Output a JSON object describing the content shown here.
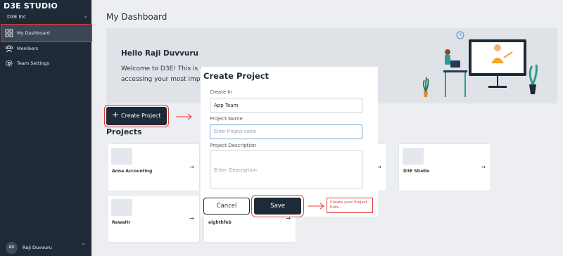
{
  "sidebar": {
    "brand": "D3E STUDIO",
    "org": "D3E Inc",
    "items": [
      {
        "label": "My Dashboard",
        "icon": "dashboard-icon",
        "active": true
      },
      {
        "label": "Members",
        "icon": "members-icon"
      },
      {
        "label": "Team Settings",
        "icon": "settings-icon"
      }
    ],
    "user": {
      "initials": "RD",
      "name": "Raji Duvvuru"
    }
  },
  "main": {
    "title": "My Dashboard",
    "banner": {
      "hello": "Hello Raji Duvvuru",
      "welcome_line1": "Welcome to D3E! This is w",
      "welcome_line2": "accessing your most impo"
    },
    "create_button": {
      "label": "Create Project",
      "icon": "plus-icon"
    },
    "projects_heading": "Projects",
    "projects": [
      {
        "name": "Anna Accounting"
      },
      {
        "name": "D3E Studio"
      },
      {
        "name": "RewaHr"
      },
      {
        "name": "eighthfeb"
      }
    ]
  },
  "modal": {
    "title": "Create Project",
    "create_in_label": "Create In",
    "create_in_value": "App Team",
    "name_label": "Project Name",
    "name_placeholder": "Enter Project name",
    "desc_label": "Project Description",
    "desc_placeholder": "Enter Description",
    "cancel": "Cancel",
    "save": "Save"
  },
  "annotation": {
    "callout_text": "Create your Project here..",
    "color": "#e53935"
  },
  "colors": {
    "sidebar": "#1e2a38",
    "accent": "#e53935",
    "banner": "#dfe3e8"
  }
}
